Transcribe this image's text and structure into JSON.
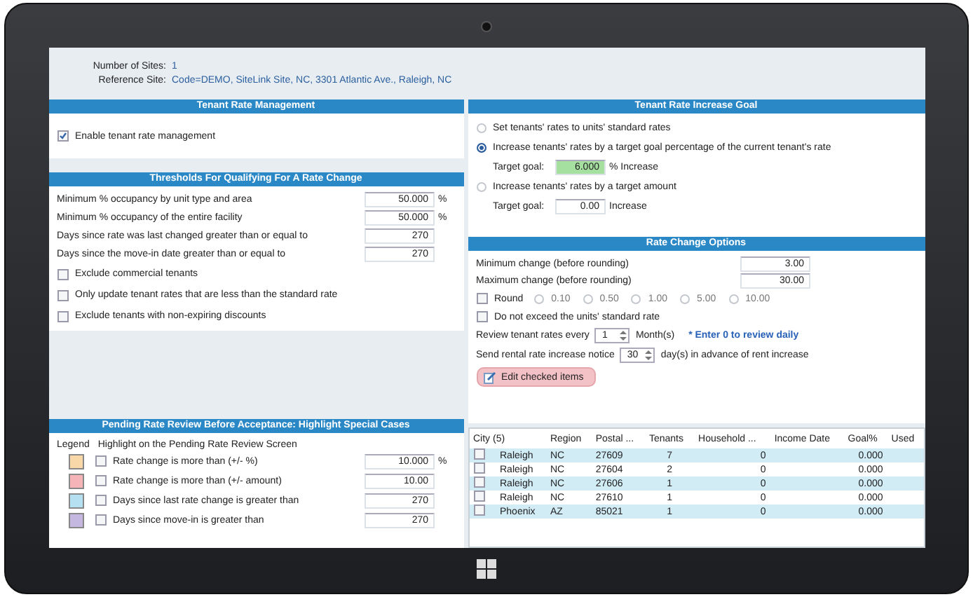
{
  "header": {
    "sites_label": "Number of Sites:",
    "sites_value": "1",
    "reference_label": "Reference Site:",
    "reference_value": "Code=DEMO,  SiteLink Site, NC, 3301 Atlantic Ave., Raleigh, NC"
  },
  "tenant_rate_management": {
    "title": "Tenant Rate Management",
    "checkboxes": [
      {
        "label": "Enable tenant rate management",
        "checked": true
      }
    ]
  },
  "thresholds": {
    "title": "Thresholds For Qualifying For A Rate Change",
    "fields": [
      {
        "label": "Minimum % occupancy by unit type and area",
        "value": "50.000",
        "unit": "%"
      },
      {
        "label": "Minimum % occupancy of the entire facility",
        "value": "50.000",
        "unit": "%"
      },
      {
        "label": "Days since rate was last changed greater than or equal to",
        "value": "270"
      },
      {
        "label": "Days since the move-in date greater than or equal to",
        "value": "270"
      }
    ],
    "checkboxes": [
      {
        "label": "Exclude commercial tenants",
        "checked": false
      },
      {
        "label": "Only update tenant rates that are less than the standard rate",
        "checked": false
      },
      {
        "label": "Exclude tenants with non-expiring discounts",
        "checked": false
      }
    ]
  },
  "pending_review": {
    "title": "Pending Rate Review Before Acceptance:  Highlight Special Cases",
    "legend_label": "Legend",
    "highlight_label": "Highlight on the Pending Rate Review Screen",
    "rows": [
      {
        "color": "#f8d7a8",
        "label": "Rate change is more than (+/- %)",
        "checked": false,
        "value": "10.000",
        "unit": "%"
      },
      {
        "color": "#f4b4b8",
        "label": "Rate change is more than (+/- amount)",
        "checked": false,
        "value": "10.00"
      },
      {
        "color": "#b4e0f2",
        "label": "Days since last rate change is greater than",
        "checked": false,
        "value": "270"
      },
      {
        "color": "#c4b8e0",
        "label": "Days since move-in is greater than",
        "checked": false,
        "value": "270"
      }
    ]
  },
  "rate_increase_goal": {
    "title": "Tenant Rate Increase Goal",
    "options": [
      {
        "label": "Set tenants' rates to units' standard rates",
        "selected": false
      },
      {
        "label": "Increase tenants' rates by a target goal percentage of the current tenant's rate",
        "selected": true,
        "target_label": "Target goal:",
        "target_value": "6.000",
        "target_unit": "% Increase"
      },
      {
        "label": "Increase tenants' rates by a target amount",
        "selected": false,
        "target_label": "Target goal:",
        "target_value": "0.00",
        "target_unit": "Increase"
      }
    ]
  },
  "rate_change_options": {
    "title": "Rate Change Options",
    "fields": [
      {
        "label": "Minimum change (before rounding)",
        "value": "3.00"
      },
      {
        "label": "Maximum change (before rounding)",
        "value": "30.00"
      }
    ],
    "round": {
      "label": "Round",
      "checked": false,
      "choices": [
        {
          "label": "0.10",
          "selected": false
        },
        {
          "label": "0.50",
          "selected": false
        },
        {
          "label": "1.00",
          "selected": false
        },
        {
          "label": "5.00",
          "selected": false
        },
        {
          "label": "10.00",
          "selected": false
        }
      ]
    },
    "checkboxes": [
      {
        "label": "Do not exceed the units' standard rate",
        "checked": false
      }
    ],
    "review": {
      "label": "Review tenant rates every",
      "value": "1",
      "unit": "Month(s)",
      "note": "* Enter 0 to review daily"
    },
    "notice": {
      "label": "Send rental rate increase notice",
      "value": "30",
      "unit": "day(s) in advance of rent increase"
    },
    "edit_button": "Edit checked items"
  },
  "grid": {
    "columns": [
      "City (5)",
      "Region",
      "Postal ...",
      "Tenants",
      "Household ...",
      "Income Date",
      "Goal%",
      "Used"
    ],
    "rows": [
      {
        "checked": false,
        "city": "Raleigh",
        "region": "NC",
        "postal": "27609",
        "tenants": "7",
        "household": "0",
        "goal": "0.000"
      },
      {
        "checked": false,
        "city": "Raleigh",
        "region": "NC",
        "postal": "27604",
        "tenants": "2",
        "household": "0",
        "goal": "0.000"
      },
      {
        "checked": false,
        "city": "Raleigh",
        "region": "NC",
        "postal": "27606",
        "tenants": "1",
        "household": "0",
        "goal": "0.000"
      },
      {
        "checked": false,
        "city": "Raleigh",
        "region": "NC",
        "postal": "27610",
        "tenants": "1",
        "household": "0",
        "goal": "0.000"
      },
      {
        "checked": false,
        "city": "Phoenix",
        "region": "AZ",
        "postal": "85021",
        "tenants": "1",
        "household": "0",
        "goal": "0.000"
      }
    ]
  }
}
